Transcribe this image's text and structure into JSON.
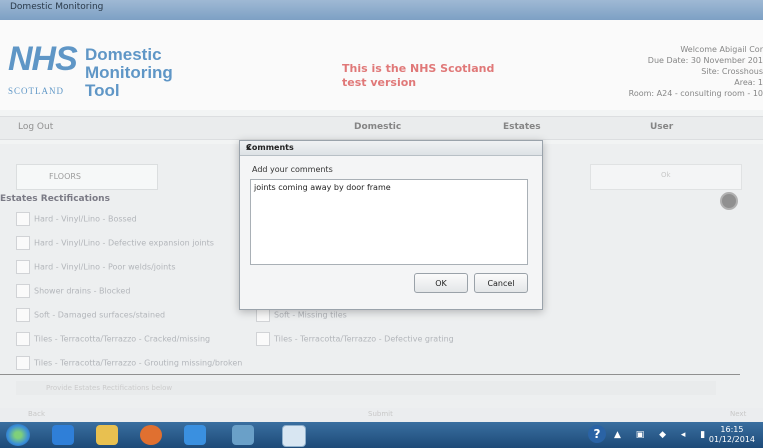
{
  "window": {
    "title": "Domestic Monitoring"
  },
  "header": {
    "logo_main": "NHS",
    "logo_sub": "SCOTLAND",
    "app_name_line1": "Domestic",
    "app_name_line2": "Monitoring",
    "app_name_line3": "Tool",
    "notice_line1": "This is the NHS Scotland",
    "notice_line2": "test version",
    "welcome": "Welcome Abigail Cor",
    "due_date": "Due Date: 30 November 201",
    "site": "Site: Crosshous",
    "area": "Area: 1",
    "room": "Room: A24 - consulting room - 10"
  },
  "nav": {
    "left": "Log Out",
    "domestic": "Domestic",
    "estates": "Estates",
    "user": "User"
  },
  "content": {
    "tab_label": "FLOORS",
    "tab_right": "Ok",
    "section_title": "Estates Rectifications",
    "left_items": [
      "Hard - Vinyl/Lino - Bossed",
      "Hard - Vinyl/Lino - Defective expansion joints",
      "Hard - Vinyl/Lino - Poor welds/joints",
      "Shower drains - Blocked",
      "Soft - Damaged surfaces/stained",
      "Tiles - Terracotta/Terrazzo - Cracked/missing",
      "Tiles - Terracotta/Terrazzo - Grouting missing/broken"
    ],
    "right_items": [
      "Soft - Missing tiles",
      "Tiles - Terracotta/Terrazzo - Defective grating"
    ],
    "bottom_bar": "Provide Estates Rectifications below",
    "footer_left": "Back",
    "footer_mid": "Submit",
    "footer_right": "Next"
  },
  "dialog": {
    "title": "Comments",
    "close": "x",
    "prompt": "Add your comments",
    "comment_value": "joints coming away by door frame",
    "ok_label": "OK",
    "cancel_label": "Cancel"
  },
  "taskbar": {
    "help": "?",
    "tray_icons": "▲ ▣ ◆ ◂ ▮",
    "time": "16:15",
    "date": "01/12/2014"
  },
  "colors": {
    "brand": "#0a5fa8",
    "notice": "#d03030",
    "taskbar": "#1d4a78"
  }
}
